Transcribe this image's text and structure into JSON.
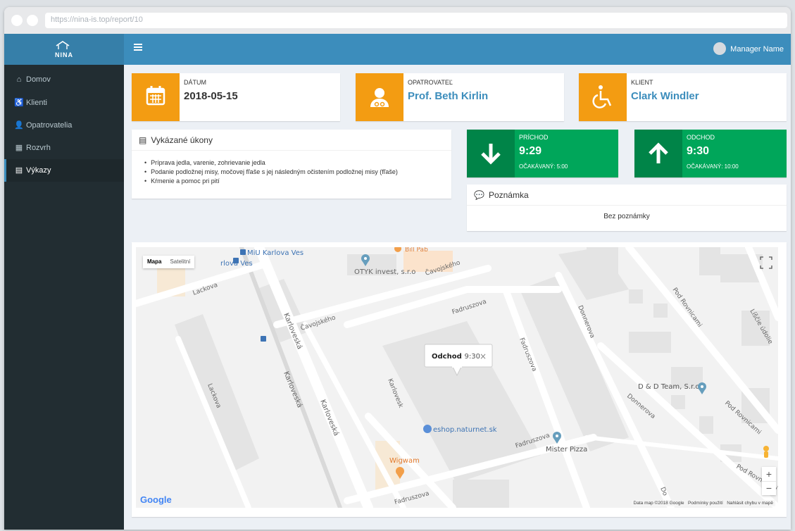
{
  "browser": {
    "url": "https://nina-is.top/report/10"
  },
  "app": {
    "logo_text": "NINA"
  },
  "sidebar": {
    "items": [
      {
        "label": "Domov",
        "icon": "home-icon"
      },
      {
        "label": "Klienti",
        "icon": "wheelchair-icon"
      },
      {
        "label": "Opatrovatelia",
        "icon": "users-icon"
      },
      {
        "label": "Rozvrh",
        "icon": "calendar-icon"
      },
      {
        "label": "Výkazy",
        "icon": "id-card-icon",
        "active": true
      }
    ]
  },
  "header": {
    "user_name": "Manager Name"
  },
  "info": {
    "date_label": "DÁTUM",
    "date_value": "2018-05-15",
    "caregiver_label": "OPATROVATEĽ",
    "caregiver_value": "Prof. Beth Kirlin",
    "client_label": "KLIENT",
    "client_value": "Clark Windler"
  },
  "tasks": {
    "title": "Vykázané úkony",
    "items": [
      "Príprava jedla, varenie, zohrievanie jedla",
      "Podanie podložnej misy, močovej fľaše s jej následným očistením podložnej misy (fľaše)",
      "Kŕmenie a pomoc pri pití"
    ]
  },
  "arrival": {
    "label": "PRÍCHOD",
    "time": "9:29",
    "expected": "OČAKÁVANÝ: 5:00"
  },
  "departure": {
    "label": "ODCHOD",
    "time": "9:30",
    "expected": "OČAKÁVANÝ: 10:00"
  },
  "note": {
    "title": "Poznámka",
    "text": "Bez poznámky"
  },
  "map": {
    "type_map": "Mapa",
    "type_satellite": "Satelitní",
    "popup_bold": "Odchod",
    "popup_time": ": 9:30",
    "popup_close": "×",
    "labels": {
      "karlova_ves": "rlova Ves",
      "miu": "MiU Karlova Ves",
      "bill_pab": "Bill Pab",
      "otyk": "OTYK invest, s.r.o",
      "cavojskeho1": "Čavojského",
      "cavojskeho2": "Čavojského",
      "lackova1": "Lackova",
      "lackova2": "Lackova",
      "karloveska1": "Karloveská",
      "karloveska2": "Karloveská",
      "karloveska3": "Karloveská",
      "karloveska4": "Karlovesk",
      "fadruszova1": "Fadruszova",
      "fadruszova2": "Fadruszova",
      "fadruszova3": "Fadruszova",
      "fadruszova4": "Fadruszova",
      "donnerova1": "Donnerova",
      "donnerova2": "Donnerova",
      "donnerova3": "Do",
      "pod_rovnicami1": "Pod Rovnicami",
      "pod_rovnicami2": "Pod Rovnicami",
      "pod_rovnicami3": "Pod Rovnicami",
      "lisie": "Líščie údolie",
      "dd_team": "D & D Team, S.r.o",
      "eshop": "eshop.naturnet.sk",
      "mister_pizza": "Mister Pizza",
      "wigwam": "Wigwam"
    },
    "google": "Google",
    "footer": "Data map ©2018 Google   Podmínky použití   Nahlásit chybu v mapě",
    "zoom_in": "+",
    "zoom_out": "−"
  },
  "colors": {
    "primary": "#3c8dbc",
    "sidebar": "#222d32",
    "orange": "#f39c12",
    "green": "#00a65a",
    "map_pin": "#669ebd",
    "map_poi": "#f29f4a"
  }
}
